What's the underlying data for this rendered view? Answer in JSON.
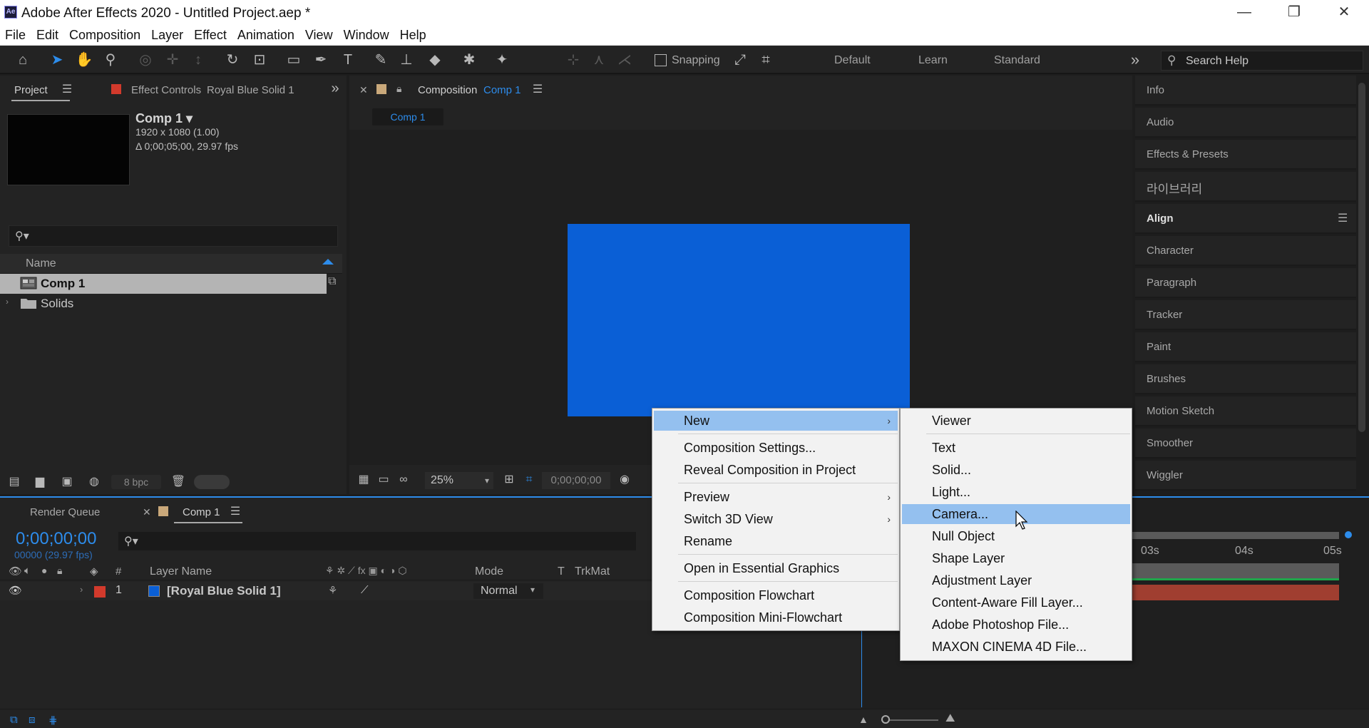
{
  "window": {
    "title": "Adobe After Effects 2020 - Untitled Project.aep *",
    "logo_text": "Ae",
    "minimize": "—",
    "restore": "❐",
    "close": "✕"
  },
  "menu": [
    "File",
    "Edit",
    "Composition",
    "Layer",
    "Effect",
    "Animation",
    "View",
    "Window",
    "Help"
  ],
  "toolbar": {
    "snapping_label": "Snapping",
    "workspaces": [
      "Default",
      "Learn",
      "Standard"
    ],
    "more": "»",
    "search_placeholder": "Search Help"
  },
  "project": {
    "tab_project": "Project",
    "tab_effect_controls": "Effect Controls",
    "effect_controls_target": "Royal Blue Solid 1",
    "comp_name": "Comp 1 ▾",
    "comp_size": "1920 x 1080 (1.00)",
    "comp_duration": "Δ 0;00;05;00, 29.97 fps",
    "column_name": "Name",
    "items": [
      {
        "label": "Comp 1",
        "type": "composition",
        "selected": true
      },
      {
        "label": "Solids",
        "type": "folder",
        "selected": false
      }
    ],
    "bpc": "8 bpc",
    "solid_color": "#0a5fd6"
  },
  "composition": {
    "tab_label": "Composition",
    "tab_comp": "Comp 1",
    "crumb": "Comp 1",
    "zoom": "25%",
    "timecode": "0;00;00;00"
  },
  "right_panels": [
    "Info",
    "Audio",
    "Effects & Presets",
    "라이브러리",
    "Align",
    "Character",
    "Paragraph",
    "Tracker",
    "Paint",
    "Brushes",
    "Motion Sketch",
    "Smoother",
    "Wiggler"
  ],
  "timeline": {
    "tab_render_queue": "Render Queue",
    "tab_comp": "Comp 1",
    "timecode": "0;00;00;00",
    "frames": "00000 (29.97 fps)",
    "columns": {
      "number": "#",
      "layer_name": "Layer Name",
      "mode": "Mode",
      "t": "T",
      "trkmat": "TrkMat"
    },
    "layer": {
      "index": "1",
      "name": "[Royal Blue Solid 1]",
      "mode": "Normal"
    },
    "ruler": [
      "03s",
      "04s",
      "05s"
    ]
  },
  "context_menu": {
    "items": [
      {
        "label": "New",
        "submenu": true,
        "highlighted": true
      },
      {
        "label": "Composition Settings...",
        "submenu": false
      },
      {
        "label": "Reveal Composition in Project",
        "submenu": false
      },
      {
        "label": "Preview",
        "submenu": true
      },
      {
        "label": "Switch 3D View",
        "submenu": true
      },
      {
        "label": "Rename",
        "submenu": false
      },
      {
        "label": "Open in Essential Graphics",
        "submenu": false
      },
      {
        "label": "Composition Flowchart",
        "submenu": false
      },
      {
        "label": "Composition Mini-Flowchart",
        "submenu": false
      }
    ]
  },
  "submenu_new": {
    "items": [
      {
        "label": "Viewer"
      },
      {
        "label": "Text"
      },
      {
        "label": "Solid..."
      },
      {
        "label": "Light..."
      },
      {
        "label": "Camera...",
        "highlighted": true
      },
      {
        "label": "Null Object"
      },
      {
        "label": "Shape Layer"
      },
      {
        "label": "Adjustment Layer"
      },
      {
        "label": "Content-Aware Fill Layer..."
      },
      {
        "label": "Adobe Photoshop File..."
      },
      {
        "label": "MAXON CINEMA 4D File..."
      }
    ]
  }
}
